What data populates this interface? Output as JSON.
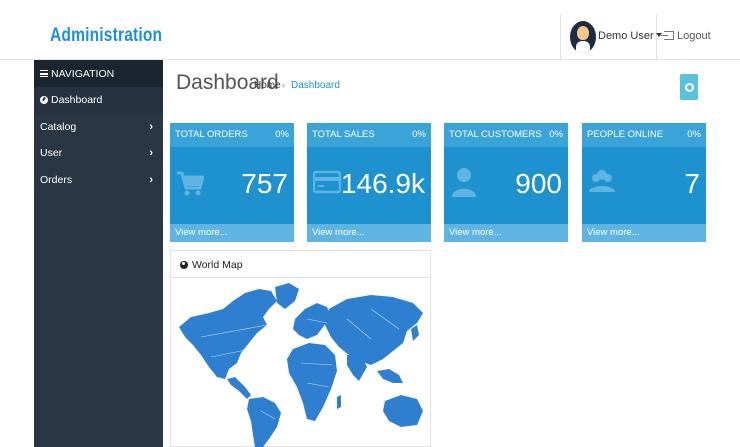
{
  "header": {
    "logo": "Administration",
    "user_name": "Demo User",
    "logout_label": "Logout"
  },
  "sidebar": {
    "title": "NAVIGATION",
    "items": [
      {
        "label": "Dashboard",
        "active": true
      },
      {
        "label": "Catalog",
        "chevron": "›"
      },
      {
        "label": "User",
        "chevron": "›"
      },
      {
        "label": "Orders",
        "chevron": "›"
      }
    ]
  },
  "page": {
    "title": "Dashboard",
    "breadcrumb": [
      "Home",
      "›",
      "Dashboard"
    ]
  },
  "tiles": [
    {
      "label": "TOTAL ORDERS",
      "percent": "0%",
      "value": "757",
      "link": "View more...",
      "icon": "cart-icon"
    },
    {
      "label": "TOTAL SALES",
      "percent": "0%",
      "value": "146.9k",
      "link": "View more...",
      "icon": "credit-card-icon"
    },
    {
      "label": "TOTAL CUSTOMERS",
      "percent": "0%",
      "value": "900",
      "link": "View more...",
      "icon": "user-icon"
    },
    {
      "label": "PEOPLE ONLINE",
      "percent": "0%",
      "value": "7",
      "link": "View more...",
      "icon": "users-icon"
    }
  ],
  "map": {
    "title": "World Map"
  },
  "colors": {
    "brand": "#1e91cf",
    "sidebar": "#2a3644",
    "tile": "#1e91cf",
    "map_land": "#2f7fd0"
  }
}
